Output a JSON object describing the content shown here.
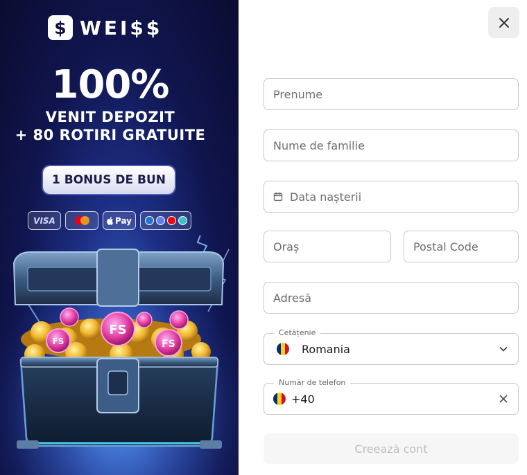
{
  "promo": {
    "brand_mark": "$",
    "brand_name": "WEI$$",
    "headline_big": "100%",
    "headline_line1": "VENIT DEPOZIT",
    "headline_line2": "+ 80 ROTIRI GRATUITE",
    "bonus_pill": "1 BONUS DE BUN",
    "payments": {
      "visa": "VISA",
      "apple_pay": "Pay"
    },
    "coin_label": "FS"
  },
  "form": {
    "first_name_placeholder": "Prenume",
    "last_name_placeholder": "Nume de familie",
    "birthdate_placeholder": "Data nașterii",
    "city_placeholder": "Oraș",
    "postal_placeholder": "Postal Code",
    "address_placeholder": "Adresă",
    "citizenship_label": "Cetățenie",
    "citizenship_value": "Romania",
    "phone_label": "Număr de telefon",
    "phone_prefix": "+40",
    "submit_label": "Creează cont"
  },
  "colors": {
    "accent_dark": "#0e1140",
    "border": "#c8c8cc",
    "flag_blue": "#002b7f",
    "flag_yellow": "#fcd116",
    "flag_red": "#ce1126"
  },
  "icons": [
    "close-icon",
    "calendar-icon",
    "chevron-down-icon",
    "clear-icon",
    "flag-romania-icon"
  ]
}
